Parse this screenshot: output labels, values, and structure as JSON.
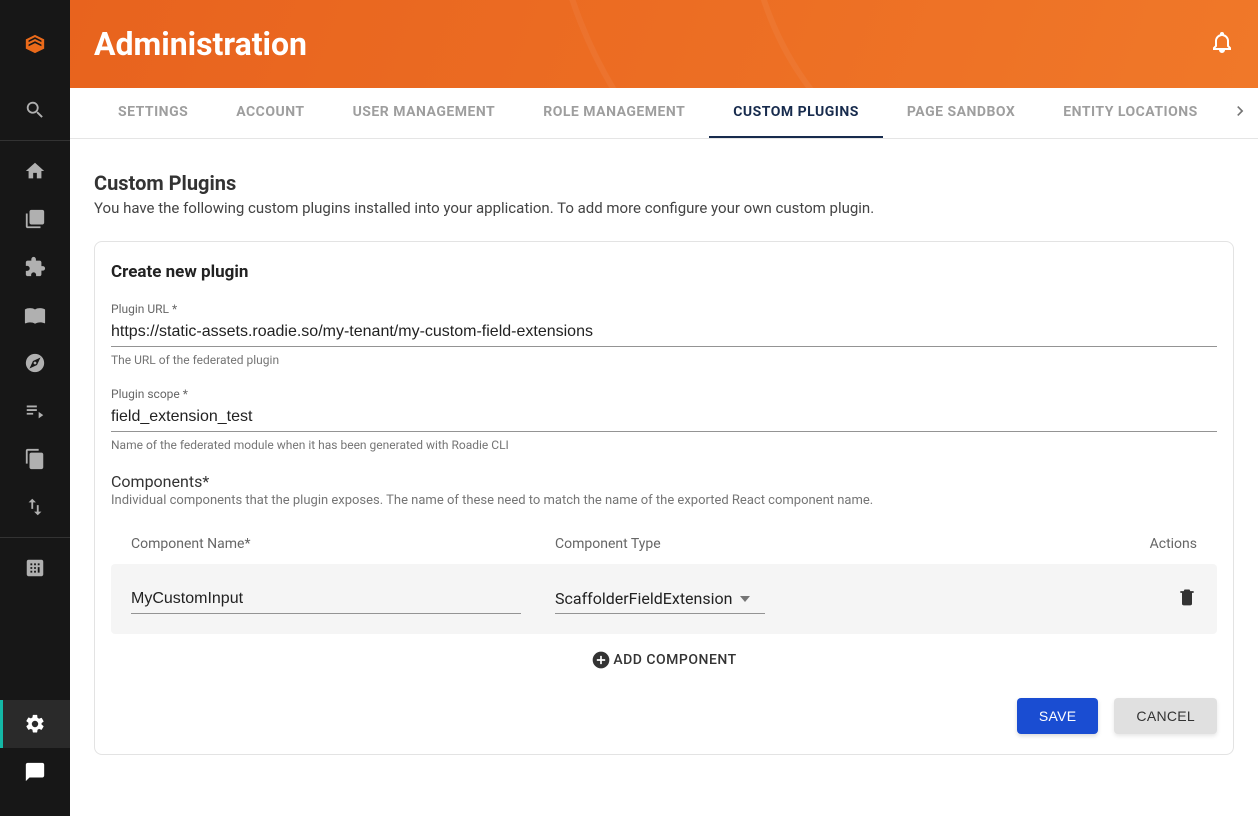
{
  "header": {
    "title": "Administration"
  },
  "tabs": [
    {
      "label": "SETTINGS",
      "active": false
    },
    {
      "label": "ACCOUNT",
      "active": false
    },
    {
      "label": "USER MANAGEMENT",
      "active": false
    },
    {
      "label": "ROLE MANAGEMENT",
      "active": false
    },
    {
      "label": "CUSTOM PLUGINS",
      "active": true
    },
    {
      "label": "PAGE SANDBOX",
      "active": false
    },
    {
      "label": "ENTITY LOCATIONS",
      "active": false
    }
  ],
  "page": {
    "title": "Custom Plugins",
    "description": "You have the following custom plugins installed into your application. To add more configure your own custom plugin."
  },
  "form": {
    "title": "Create new plugin",
    "plugin_url": {
      "label": "Plugin URL *",
      "value": "https://static-assets.roadie.so/my-tenant/my-custom-field-extensions",
      "help": "The URL of the federated plugin"
    },
    "plugin_scope": {
      "label": "Plugin scope *",
      "value": "field_extension_test",
      "help": "Name of the federated module when it has been generated with Roadie CLI"
    },
    "components": {
      "label": "Components*",
      "help": "Individual components that the plugin exposes. The name of these need to match the name of the exported React component name.",
      "columns": {
        "name": "Component Name*",
        "type": "Component Type",
        "actions": "Actions"
      },
      "rows": [
        {
          "name": "MyCustomInput",
          "type": "ScaffolderFieldExtension"
        }
      ],
      "add_label": "ADD COMPONENT"
    },
    "save_label": "SAVE",
    "cancel_label": "CANCEL"
  }
}
